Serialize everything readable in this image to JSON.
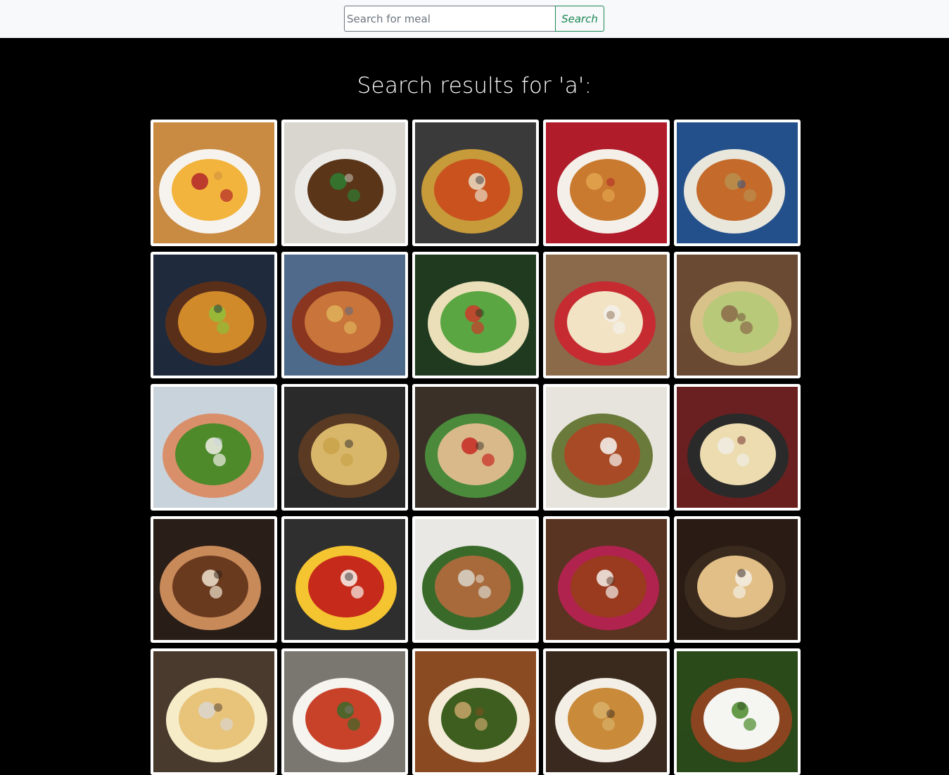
{
  "search": {
    "placeholder": "Search for meal",
    "value": "",
    "button_label": "Search"
  },
  "results": {
    "heading": "Search results for 'a':",
    "meals": [
      {
        "icon": "soup-bowl-icon",
        "palette": [
          "#c98a42",
          "#f2b43c",
          "#f6f3ee",
          "#b3262a"
        ]
      },
      {
        "icon": "falafel-plate-icon",
        "palette": [
          "#d9d6cf",
          "#5a3518",
          "#ecebe7",
          "#2f7d32"
        ]
      },
      {
        "icon": "curry-bowl-icon",
        "palette": [
          "#3a3a3a",
          "#c9521e",
          "#c79a3a",
          "#e8dcc4"
        ]
      },
      {
        "icon": "lasagne-dish-icon",
        "palette": [
          "#b01c2a",
          "#c97a2e",
          "#f4efe8",
          "#e3a44d"
        ]
      },
      {
        "icon": "salad-plate-icon",
        "palette": [
          "#23508a",
          "#c46a2a",
          "#e9e6dc",
          "#b98f4f"
        ]
      },
      {
        "icon": "burger-icon",
        "palette": [
          "#1f2a3c",
          "#d08a2a",
          "#5a2f1a",
          "#8fbf3a"
        ]
      },
      {
        "icon": "koshari-plate-icon",
        "palette": [
          "#4f6a8a",
          "#c8743a",
          "#8a3520",
          "#e0b25a"
        ]
      },
      {
        "icon": "taco-plate-icon",
        "palette": [
          "#1f3a1f",
          "#5aa642",
          "#eadfb8",
          "#cc3a2a"
        ]
      },
      {
        "icon": "pancakes-icon",
        "palette": [
          "#8a6a4a",
          "#f2e3c4",
          "#c62b32",
          "#f4f1ec"
        ]
      },
      {
        "icon": "quiche-icon",
        "palette": [
          "#6a4a32",
          "#b8c97a",
          "#d9c28a",
          "#8a6a4a"
        ]
      },
      {
        "icon": "sausage-kale-plate-icon",
        "palette": [
          "#c9d3db",
          "#4e8a2a",
          "#d98f6a",
          "#f1efe9"
        ]
      },
      {
        "icon": "moussaka-pan-icon",
        "palette": [
          "#2a2a2a",
          "#d9b76a",
          "#5a3a22",
          "#c9a24a"
        ]
      },
      {
        "icon": "chicken-wrap-icon",
        "palette": [
          "#3a3028",
          "#d9b98a",
          "#4a8a3a",
          "#c62a22"
        ]
      },
      {
        "icon": "minestrone-bowl-icon",
        "palette": [
          "#e7e4de",
          "#a84a26",
          "#6a7a3a",
          "#f7f5f1"
        ]
      },
      {
        "icon": "udon-noodles-icon",
        "palette": [
          "#6a2020",
          "#ecdcb0",
          "#2a2a2a",
          "#f0ece4"
        ]
      },
      {
        "icon": "maple-pie-icon",
        "palette": [
          "#2a1e18",
          "#6a3a1f",
          "#c98a5a",
          "#f0e4d0"
        ]
      },
      {
        "icon": "shakshuka-pan-icon",
        "palette": [
          "#2f2f2f",
          "#c62a1a",
          "#f5c431",
          "#f7f4ee"
        ]
      },
      {
        "icon": "noodles-chopsticks-icon",
        "palette": [
          "#e9e8e4",
          "#a86a3a",
          "#3a6a2a",
          "#d9d5cc"
        ]
      },
      {
        "icon": "braised-dish-icon",
        "palette": [
          "#5a3422",
          "#9a3a1e",
          "#b0234e",
          "#f4f0ea"
        ]
      },
      {
        "icon": "rock-cakes-icon",
        "palette": [
          "#2a1c14",
          "#e2bf86",
          "#3a2a1e",
          "#f4efe6"
        ]
      },
      {
        "icon": "cheese-bake-icon",
        "palette": [
          "#4a3a2e",
          "#e8c37a",
          "#f6ecc8",
          "#d9d6d0"
        ]
      },
      {
        "icon": "mapo-tofu-bowl-icon",
        "palette": [
          "#7a7670",
          "#c8422a",
          "#f6f4ef",
          "#3a6a2a"
        ]
      },
      {
        "icon": "green-soup-icon",
        "palette": [
          "#8a4a22",
          "#3d5e1e",
          "#f4ecd8",
          "#c8a46a"
        ]
      },
      {
        "icon": "stuffed-bread-icon",
        "palette": [
          "#3a2a1e",
          "#c98a3a",
          "#f4efe6",
          "#d9b26a"
        ]
      },
      {
        "icon": "rice-fried-chicken-icon",
        "palette": [
          "#2a4a1a",
          "#f5f5f2",
          "#8a4420",
          "#4a8a2a"
        ]
      }
    ]
  }
}
